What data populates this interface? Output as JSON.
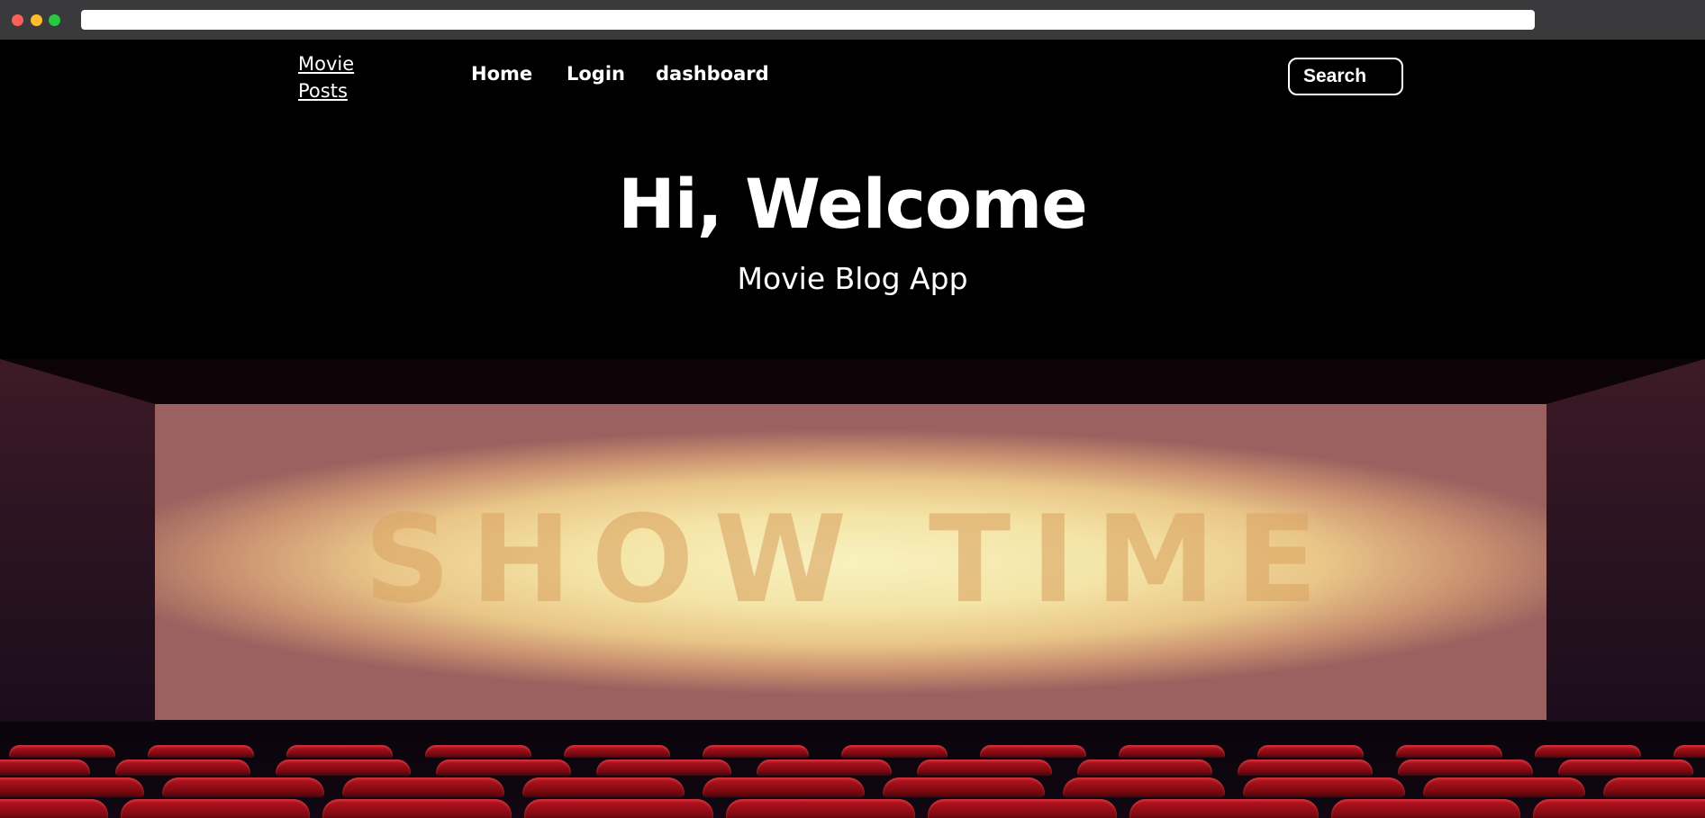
{
  "nav": {
    "brand_line1": "Movie",
    "brand_line2": "Posts",
    "home": "Home",
    "login": "Login",
    "dashboard": "dashboard",
    "search_label": "Search"
  },
  "hero": {
    "title": "Hi, Welcome",
    "subtitle": "Movie Blog App"
  },
  "banner": {
    "screen_text": "SHOW TIME"
  },
  "colors": {
    "background": "#000000",
    "text": "#ffffff",
    "seats": "#b3121c"
  }
}
